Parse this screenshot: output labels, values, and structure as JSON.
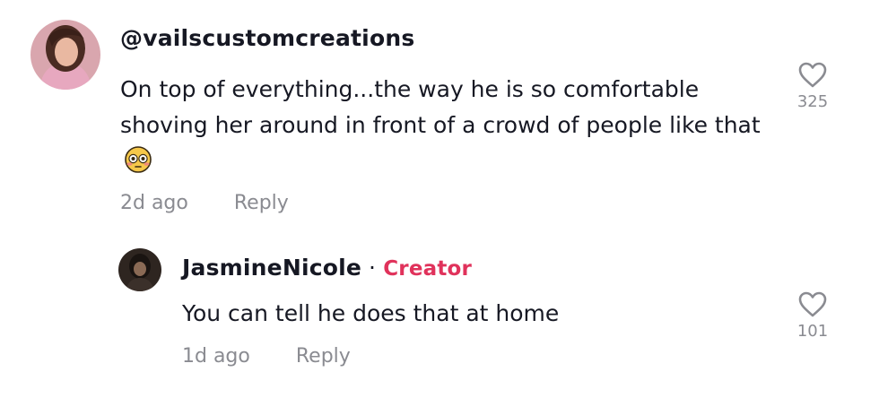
{
  "comments": [
    {
      "username": "@vailscustomcreations",
      "text": "On top of everything...the way he is so comfortable shoving her around in front of a crowd of people like that",
      "emoji": "flushed-face-emoji",
      "time": "2d ago",
      "reply_label": "Reply",
      "likes": "325"
    },
    {
      "username": "JasmineNicole",
      "separator": "·",
      "badge": "Creator",
      "text": "You can tell he does that at home",
      "time": "1d ago",
      "reply_label": "Reply",
      "likes": "101"
    }
  ],
  "colors": {
    "text": "#161823",
    "muted": "#8a8b91",
    "creator_badge": "#e0325b"
  }
}
